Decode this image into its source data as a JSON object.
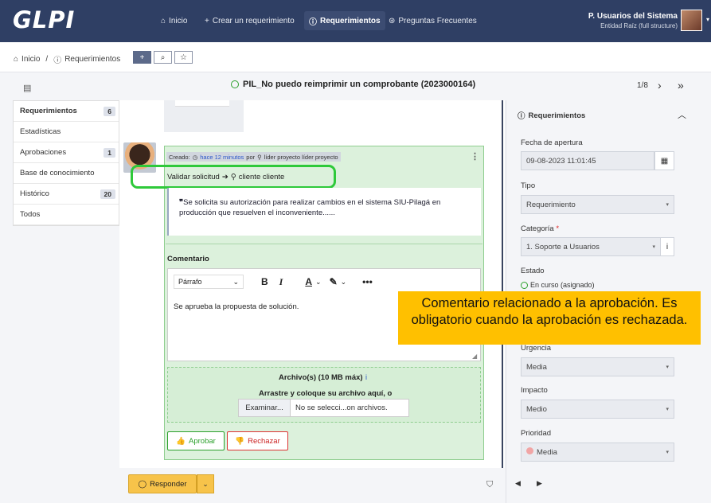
{
  "topbar": {
    "logo": "GLPI",
    "nav": [
      {
        "label": "Inicio",
        "icon": "home-icon"
      },
      {
        "label": "Crear un requerimiento",
        "icon": "plus-icon"
      },
      {
        "label": "Requerimientos",
        "icon": "alert-circle-icon",
        "active": true
      },
      {
        "label": "Preguntas Frecuentes",
        "icon": "lifebuoy-icon"
      }
    ],
    "user_name": "P. Usuarios del Sistema",
    "user_entity": "Entidad Raíz (full structure)"
  },
  "breadcrumb": {
    "items": [
      "Inicio",
      "Requerimientos"
    ],
    "separator": "/",
    "add_label": "+",
    "search_label": "⌕",
    "star_label": "☆"
  },
  "ticket": {
    "title": "PIL_No puedo reimprimir un comprobante (2023000164)",
    "pager": "1/8",
    "status_color": "#2ca02c"
  },
  "tabs": [
    {
      "label": "Requerimientos",
      "count": "6",
      "active": true
    },
    {
      "label": "Estadísticas",
      "count": ""
    },
    {
      "label": "Aprobaciones",
      "count": "1"
    },
    {
      "label": "Base de conocimiento",
      "count": ""
    },
    {
      "label": "Histórico",
      "count": "20"
    },
    {
      "label": "Todos",
      "count": ""
    }
  ],
  "validation": {
    "created_prefix": "Creado:",
    "created_time": "hace 12 minutos",
    "by": "por",
    "author": "líder proyecto líder proyecto",
    "request_label": "Validar solicitud",
    "target_user": "cliente cliente",
    "quote": "Se solicita su autorización para realizar cambios en el sistema SIU-Pilagá en producción que resuelven el inconveniente......",
    "comment_label": "Comentario",
    "paragraph_style": "Párrafo",
    "editor_text": "Se aprueba la propuesta de solución.",
    "files_label": "Archivo(s) (10 MB máx)",
    "files_info": "i",
    "drop_label": "Arrastre y coloque su archivo aquí, o",
    "browse_label": "Examinar...",
    "no_file_label": "No se selecci...on archivos.",
    "approve_label": "Aprobar",
    "reject_label": "Rechazar"
  },
  "footer": {
    "reply_label": "Responder"
  },
  "right_panel": {
    "title": "Requerimientos",
    "fecha_label": "Fecha de apertura",
    "fecha_value": "09-08-2023 11:01:45",
    "tipo_label": "Tipo",
    "tipo_value": "Requerimiento",
    "categoria_label": "Categoría",
    "categoria_required": "*",
    "categoria_value": "1. Soporte a Usuarios",
    "estado_label": "Estado",
    "estado_value": "En curso (asignado)",
    "urgencia_label": "Urgencia",
    "urgencia_value": "Media",
    "impacto_label": "Impacto",
    "impacto_value": "Medio",
    "prioridad_label": "Prioridad",
    "prioridad_value": "Media"
  },
  "callout": {
    "text": "Comentario relacionado a la aprobación. Es obligatorio cuando la aprobación es rechazada."
  }
}
